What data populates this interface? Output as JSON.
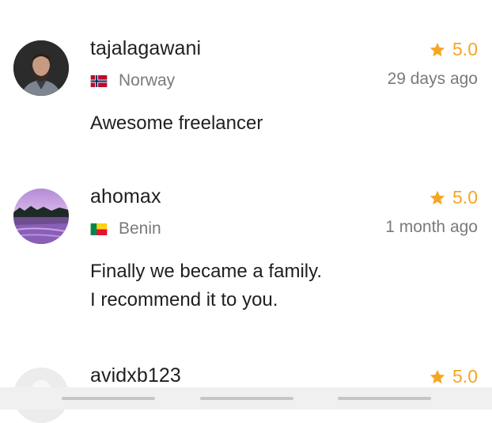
{
  "reviews": [
    {
      "username": "tajalagawani",
      "country": "Norway",
      "flag": "norway-flag",
      "rating": "5.0",
      "date": "29 days ago",
      "comment_lines": [
        "Awesome freelancer"
      ]
    },
    {
      "username": "ahomax",
      "country": "Benin",
      "flag": "benin-flag",
      "rating": "5.0",
      "date": "1 month ago",
      "comment_lines": [
        "Finally we became a family.",
        "I recommend it to you."
      ]
    },
    {
      "username": "avidxb123",
      "rating": "5.0"
    }
  ],
  "colors": {
    "star": "#f5a623",
    "secondary_text": "#7a7a7a",
    "primary_text": "#1f1f1f",
    "nav_bar": "#f0f0f0"
  },
  "icons": {
    "star": "star-icon"
  }
}
